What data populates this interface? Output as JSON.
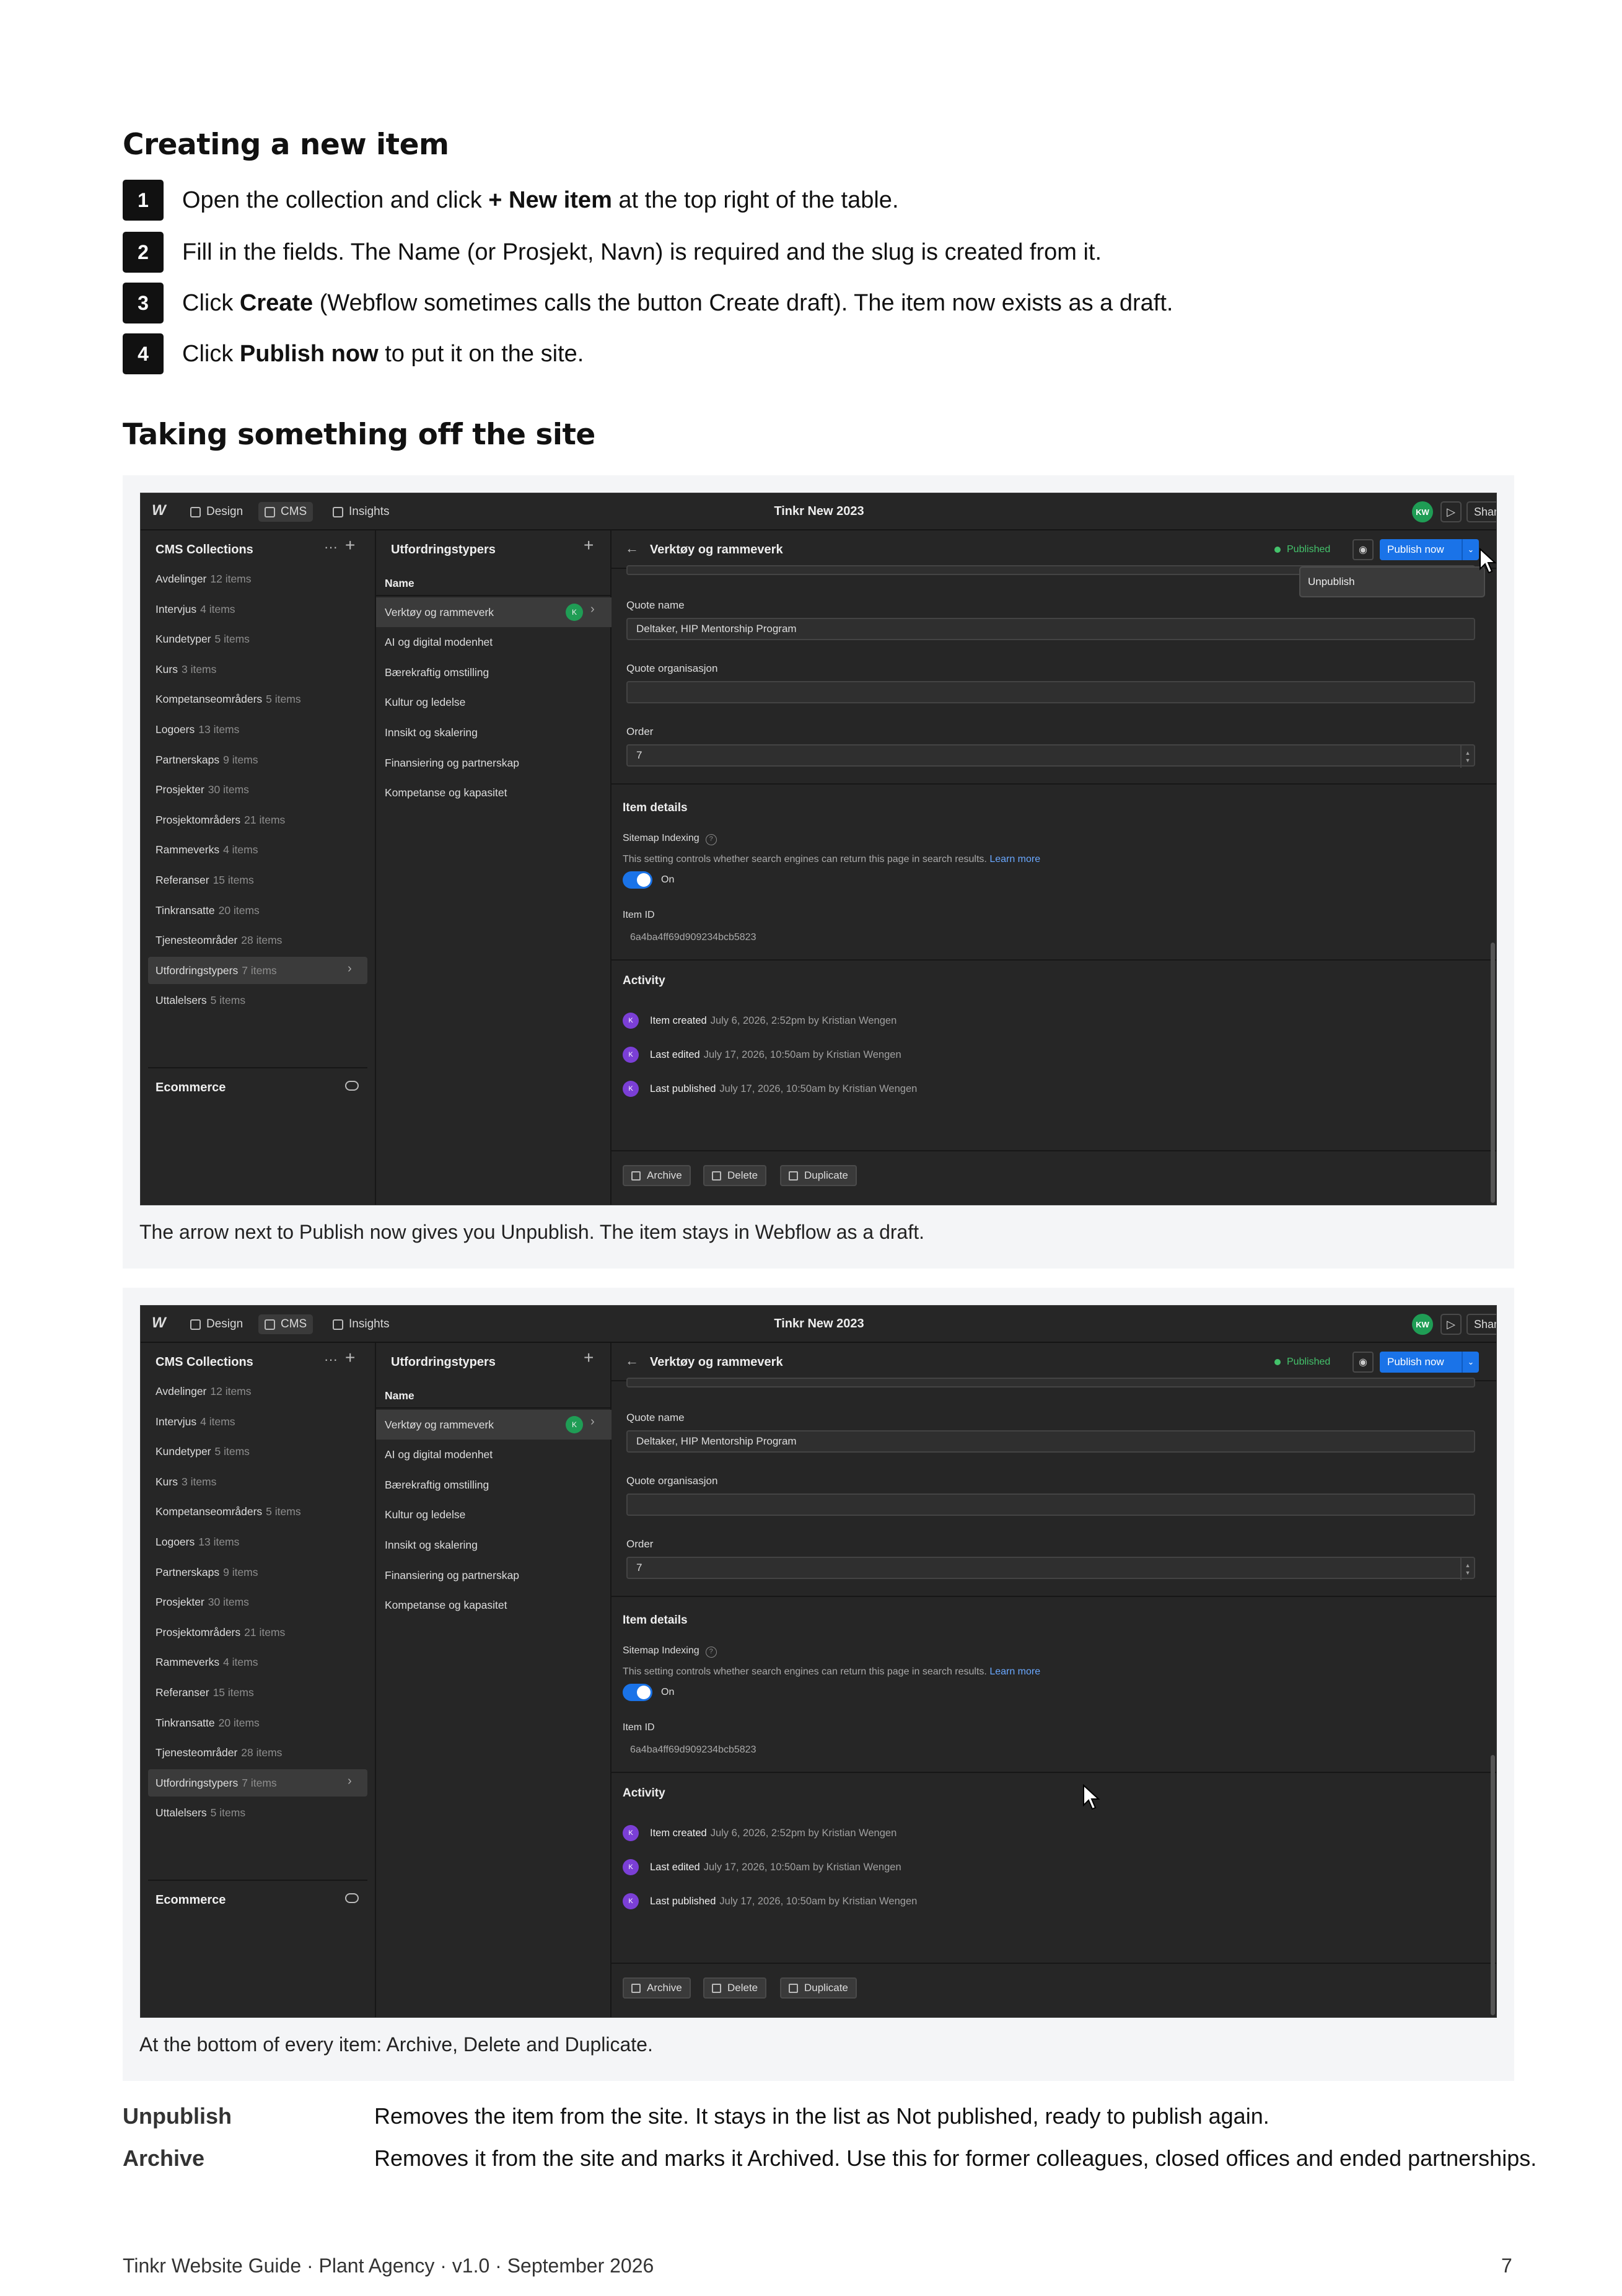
{
  "section1": {
    "heading": "Creating a new item",
    "steps": [
      {
        "num": "1",
        "pre": "Open the collection and click ",
        "bold": "+ New item",
        "post": " at the top right of the table."
      },
      {
        "num": "2",
        "pre": "Fill in the fields. The Name (or Prosjekt, Navn) is required and the slug is created from it.",
        "bold": "",
        "post": ""
      },
      {
        "num": "3",
        "pre": "Click ",
        "bold": "Create",
        "post": " (Webflow sometimes calls the button Create draft). The item now exists as a draft."
      },
      {
        "num": "4",
        "pre": "Click ",
        "bold": "Publish now",
        "post": " to put it on the site."
      }
    ]
  },
  "section2": {
    "heading": "Taking something off the site"
  },
  "ui": {
    "logo": "W",
    "tabs": {
      "design": "Design",
      "cms": "CMS",
      "insights": "Insights"
    },
    "site_title": "Tinkr New 2023",
    "avatar": "KW",
    "share": "Share",
    "cms_collections": "CMS Collections",
    "collections": [
      {
        "name": "Avdelinger",
        "count": "12 items"
      },
      {
        "name": "Intervjus",
        "count": "4 items"
      },
      {
        "name": "Kundetyper",
        "count": "5 items"
      },
      {
        "name": "Kurs",
        "count": "3 items"
      },
      {
        "name": "Kompetanseområders",
        "count": "5 items"
      },
      {
        "name": "Logoers",
        "count": "13 items"
      },
      {
        "name": "Partnerskaps",
        "count": "9 items"
      },
      {
        "name": "Prosjekter",
        "count": "30 items"
      },
      {
        "name": "Prosjektområders",
        "count": "21 items"
      },
      {
        "name": "Rammeverks",
        "count": "4 items"
      },
      {
        "name": "Referanser",
        "count": "15 items"
      },
      {
        "name": "Tinkransatte",
        "count": "20 items"
      },
      {
        "name": "Tjenesteområder",
        "count": "28 items"
      },
      {
        "name": "Utfordringstypers",
        "count": "7 items"
      },
      {
        "name": "Uttalelsers",
        "count": "5 items"
      }
    ],
    "ecommerce": "Ecommerce",
    "collection_title": "Utfordringstypers",
    "name_header": "Name",
    "items": [
      "Verktøy og rammeverk",
      "AI og digital modenhet",
      "Bærekraftig omstilling",
      "Kultur og ledelse",
      "Innsikt og skalering",
      "Finansiering og partnerskap",
      "Kompetanse og kapasitet"
    ],
    "item_badge": "K",
    "item_title": "Verktøy og rammeverk",
    "status": "Published",
    "publish_now": "Publish now",
    "unpublish_menu": "Unpublish",
    "fields": {
      "quote_name_label": "Quote name",
      "quote_name_value": "Deltaker, HIP Mentorship Program",
      "quote_org_label": "Quote organisasjon",
      "quote_org_value": "",
      "order_label": "Order",
      "order_value": "7"
    },
    "item_details": "Item details",
    "sitemap_label": "Sitemap Indexing",
    "sitemap_help": "This setting controls whether search engines can return this page in search results.",
    "learn_more": "Learn more",
    "toggle_label": "On",
    "item_id_label": "Item ID",
    "item_id_value": "6a4ba4ff69d909234bcb5823",
    "activity_title": "Activity",
    "activity": [
      {
        "action": "Item created",
        "detail": "July 6, 2026, 2:52pm by Kristian Wengen"
      },
      {
        "action": "Last edited",
        "detail": "July 17, 2026, 10:50am by Kristian Wengen"
      },
      {
        "action": "Last published",
        "detail": "July 17, 2026, 10:50am by Kristian Wengen"
      }
    ],
    "archive": "Archive",
    "delete": "Delete",
    "duplicate": "Duplicate"
  },
  "captions": {
    "fig1": "The arrow next to Publish now gives you Unpublish. The item stays in Webflow as a draft.",
    "fig2": "At the bottom of every item: Archive, Delete and Duplicate."
  },
  "definitions": [
    {
      "term": "Unpublish",
      "text": "Removes the item from the site. It stays in the list as Not published, ready to publish again."
    },
    {
      "term": "Archive",
      "text": "Removes it from the site and marks it Archived. Use this for former colleagues, closed offices and ended partnerships."
    }
  ],
  "footer": {
    "left": "Tinkr Website Guide · Plant Agency · v1.0 · September 2026",
    "page": "7"
  }
}
